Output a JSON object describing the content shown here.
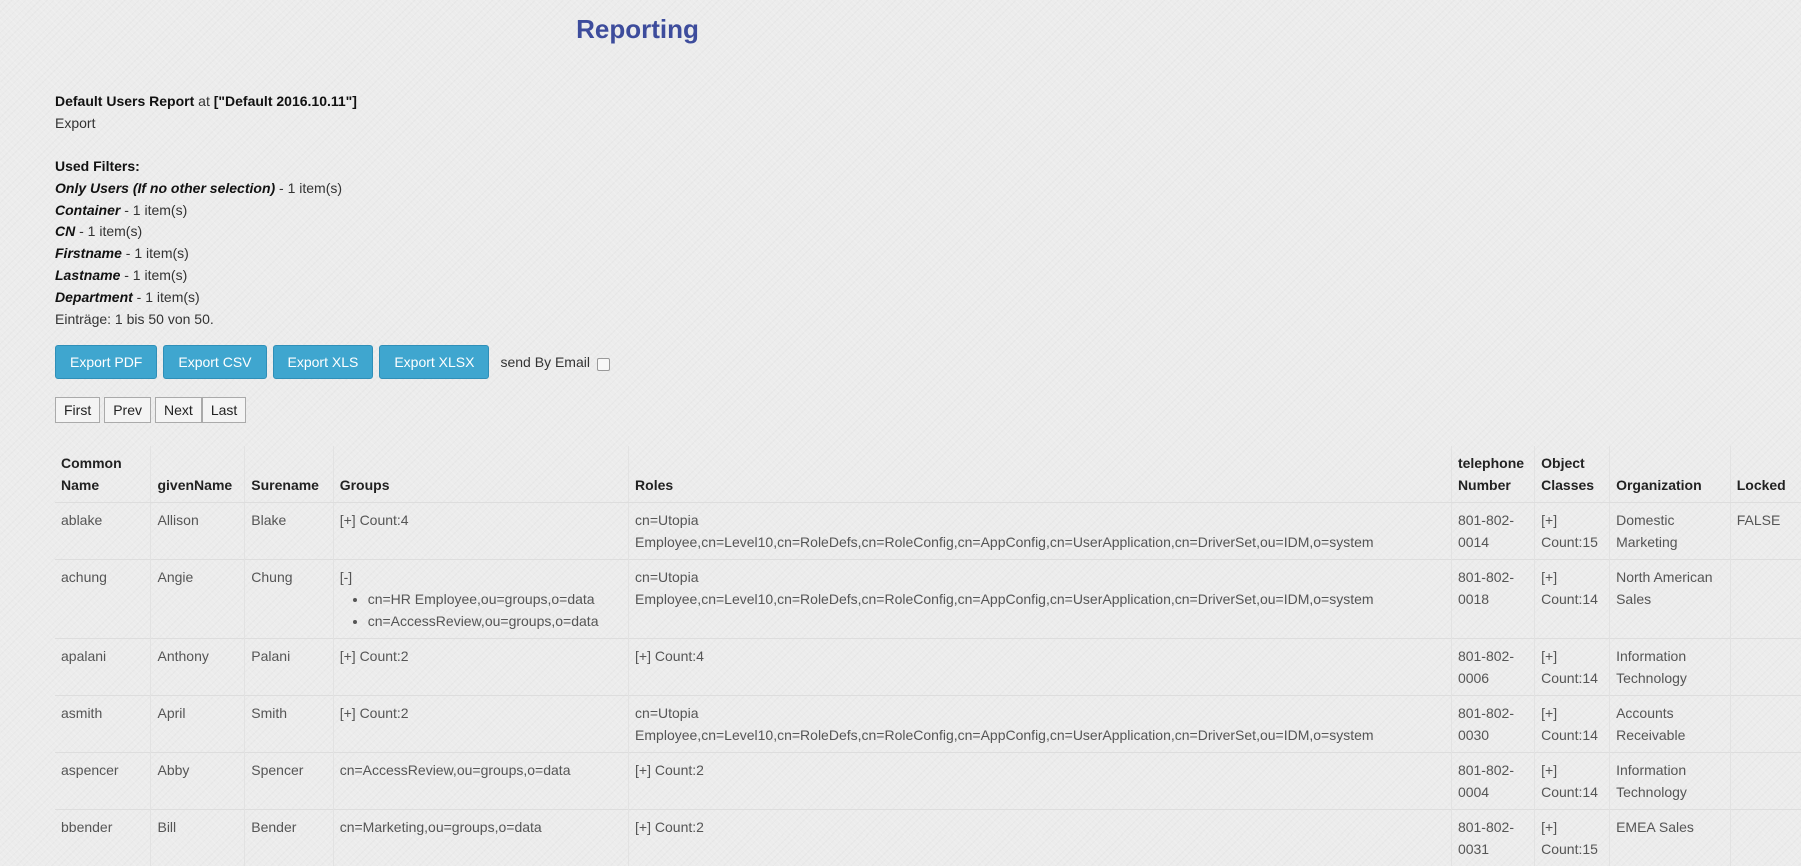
{
  "page": {
    "title": "Reporting"
  },
  "report": {
    "name": "Default Users Report",
    "at_word": "at",
    "scope": "[\"Default 2016.10.11\"]",
    "export_link": "Export"
  },
  "filters": {
    "title": "Used Filters:",
    "items": [
      {
        "name": "Only Users (If no other selection)",
        "count": " - 1 item(s)"
      },
      {
        "name": "Container",
        "count": " - 1 item(s)"
      },
      {
        "name": "CN",
        "count": " - 1 item(s)"
      },
      {
        "name": "Firstname",
        "count": " - 1 item(s)"
      },
      {
        "name": "Lastname",
        "count": " - 1 item(s)"
      },
      {
        "name": "Department",
        "count": " - 1 item(s)"
      }
    ],
    "entries": "Einträge: 1 bis 50 von 50."
  },
  "toolbar": {
    "export_pdf": "Export PDF",
    "export_csv": "Export CSV",
    "export_xls": "Export XLS",
    "export_xlsx": "Export XLSX",
    "send_email": "send By Email"
  },
  "pager": {
    "first": "First",
    "prev": "Prev",
    "next": "Next",
    "last": "Last"
  },
  "table": {
    "headers": {
      "common_name_1": "Common",
      "common_name_2": "Name",
      "given_name": "givenName",
      "surname": "Surename",
      "groups": "Groups",
      "roles": "Roles",
      "phone_1": "telephone",
      "phone_2": "Number",
      "objclass_1": "Object",
      "objclass_2": "Classes",
      "organization": "Organization",
      "locked": "Locked"
    },
    "rows": [
      {
        "cn": "ablake",
        "given": "Allison",
        "surname": "Blake",
        "groups": "[+] Count:4",
        "roles_1": "cn=Utopia",
        "roles_2": "Employee,cn=Level10,cn=RoleDefs,cn=RoleConfig,cn=AppConfig,cn=UserApplication,cn=DriverSet,ou=IDM,o=system",
        "phone_1": "801-802-",
        "phone_2": "0014",
        "oc_1": "[+]",
        "oc_2": "Count:15",
        "org_1": "Domestic",
        "org_2": "Marketing",
        "locked": "FALSE"
      },
      {
        "cn": "achung",
        "given": "Angie",
        "surname": "Chung",
        "groups_toggle": "[-]",
        "groups_list": [
          "cn=HR Employee,ou=groups,o=data",
          "cn=AccessReview,ou=groups,o=data"
        ],
        "roles_1": "cn=Utopia",
        "roles_2": "Employee,cn=Level10,cn=RoleDefs,cn=RoleConfig,cn=AppConfig,cn=UserApplication,cn=DriverSet,ou=IDM,o=system",
        "phone_1": "801-802-",
        "phone_2": "0018",
        "oc_1": "[+]",
        "oc_2": "Count:14",
        "org_1": "North American",
        "org_2": "Sales",
        "locked": ""
      },
      {
        "cn": "apalani",
        "given": "Anthony",
        "surname": "Palani",
        "groups": "[+] Count:2",
        "roles_1": "[+] Count:4",
        "roles_2": "",
        "phone_1": "801-802-",
        "phone_2": "0006",
        "oc_1": "[+]",
        "oc_2": "Count:14",
        "org_1": "Information",
        "org_2": "Technology",
        "locked": ""
      },
      {
        "cn": "asmith",
        "given": "April",
        "surname": "Smith",
        "groups": "[+] Count:2",
        "roles_1": "cn=Utopia",
        "roles_2": "Employee,cn=Level10,cn=RoleDefs,cn=RoleConfig,cn=AppConfig,cn=UserApplication,cn=DriverSet,ou=IDM,o=system",
        "phone_1": "801-802-",
        "phone_2": "0030",
        "oc_1": "[+]",
        "oc_2": "Count:14",
        "org_1": "Accounts",
        "org_2": "Receivable",
        "locked": ""
      },
      {
        "cn": "aspencer",
        "given": "Abby",
        "surname": "Spencer",
        "groups": "cn=AccessReview,ou=groups,o=data",
        "roles_1": "[+] Count:2",
        "roles_2": "",
        "phone_1": "801-802-",
        "phone_2": "0004",
        "oc_1": "[+]",
        "oc_2": "Count:14",
        "org_1": "Information",
        "org_2": "Technology",
        "locked": ""
      },
      {
        "cn": "bbender",
        "given": "Bill",
        "surname": "Bender",
        "groups": "cn=Marketing,ou=groups,o=data",
        "roles_1": "[+] Count:2",
        "roles_2": "",
        "phone_1": "801-802-",
        "phone_2": "0031",
        "oc_1": "[+]",
        "oc_2": "Count:15",
        "org_1": "EMEA Sales",
        "org_2": "",
        "locked": ""
      }
    ]
  }
}
